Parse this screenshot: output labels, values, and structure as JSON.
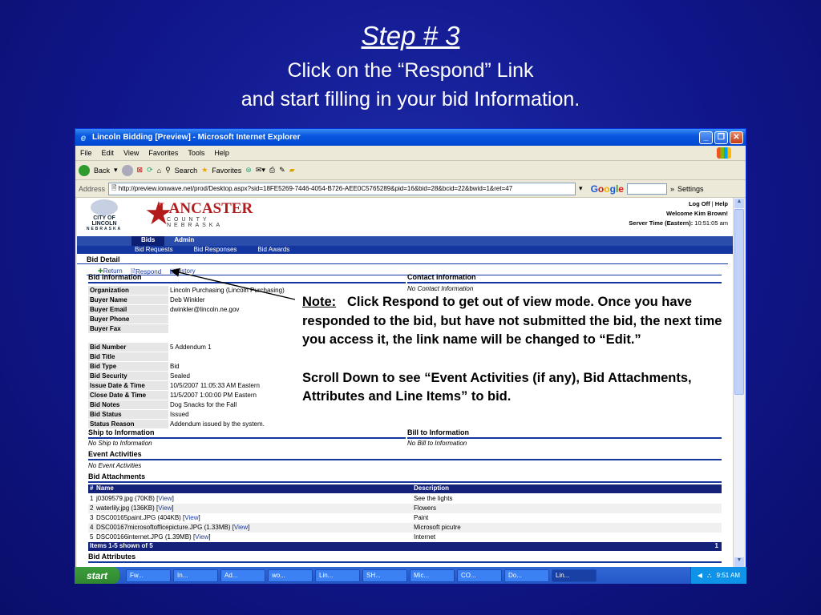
{
  "slide": {
    "step_title": "Step # 3",
    "line1": "Click on the “Respond” Link",
    "line2": "and start filling in your bid Information."
  },
  "browser": {
    "title": "Lincoln Bidding [Preview] - Microsoft Internet Explorer",
    "menu": [
      "File",
      "Edit",
      "View",
      "Favorites",
      "Tools",
      "Help"
    ],
    "toolbar": {
      "back": "Back",
      "search": "Search",
      "favorites": "Favorites"
    },
    "address_label": "Address",
    "address_url": "http://preview.ionwave.net/prod/Desktop.aspx?sid=18FE5269-7446-4054-B726-AEE0C5765289&pid=16&bid=28&bcid=22&bwid=1&ret=47",
    "settings_label": "Settings"
  },
  "page": {
    "city_logo_text": "CITY OF LINCOLN",
    "city_logo_sub": "NEBRASKA",
    "county_name": "LANCASTER",
    "county_sub": "COUNTY NEBRASKA",
    "log_off": "Log Off",
    "help": "Help",
    "welcome": "Welcome Kim Brown!",
    "server_time_label": "Server Time (Eastern):",
    "server_time": "10:51:05 am",
    "nav": [
      "Bids",
      "Admin"
    ],
    "subnav": [
      "Bid Requests",
      "Bid Responses",
      "Bid Awards"
    ],
    "bid_detail": "Bid Detail",
    "links": {
      "return": "Return",
      "respond": "Respond",
      "history": "History"
    },
    "bid_info_title": "Bid Information",
    "contact_title": "Contact Information",
    "no_contact": "No Contact Information",
    "fields": [
      {
        "label": "Organization",
        "value": "Lincoln Purchasing (Lincoln Purchasing)"
      },
      {
        "label": "Buyer Name",
        "value": "Deb Winkler"
      },
      {
        "label": "Buyer Email",
        "value": "dwinkler@lincoln.ne.gov"
      },
      {
        "label": "Buyer Phone",
        "value": ""
      },
      {
        "label": "Buyer Fax",
        "value": ""
      }
    ],
    "fields2": [
      {
        "label": "Bid Number",
        "value": "5 Addendum 1"
      },
      {
        "label": "Bid Title",
        "value": ""
      },
      {
        "label": "Bid Type",
        "value": "Bid"
      },
      {
        "label": "Bid Security",
        "value": "Sealed"
      },
      {
        "label": "Issue Date & Time",
        "value": "10/5/2007 11:05:33 AM Eastern"
      },
      {
        "label": "Close Date & Time",
        "value": "11/5/2007 1:00:00 PM Eastern"
      },
      {
        "label": "Bid Notes",
        "value": "Dog Snacks for the Fall"
      },
      {
        "label": "Bid Status",
        "value": "Issued"
      },
      {
        "label": "Status Reason",
        "value": "Addendum issued by the system."
      }
    ],
    "ship_title": "Ship to Information",
    "no_ship": "No Ship to Information",
    "bill_title": "Bill to Information",
    "no_bill": "No Bill to Information",
    "event_title": "Event Activities",
    "no_event": "No Event Activities",
    "attach_title": "Bid Attachments",
    "attach_cols": [
      "#",
      "Name",
      "Description"
    ],
    "attachments": [
      {
        "n": "1",
        "name": "j0309579.jpg (70KB)",
        "desc": "See the lights"
      },
      {
        "n": "2",
        "name": "waterlily.jpg (136KB)",
        "desc": "Flowers"
      },
      {
        "n": "3",
        "name": "DSC00165paint.JPG (404KB)",
        "desc": "Paint"
      },
      {
        "n": "4",
        "name": "DSC00167microsoftofficepicture.JPG (1.33MB)",
        "desc": "Microsoft picutre"
      },
      {
        "n": "5",
        "name": "DSC00166internet.JPG (1.39MB)",
        "desc": "Internet"
      }
    ],
    "view_label": "View",
    "items_shown": "Items 1-5 shown of 5",
    "page_num": "1",
    "attributes_title": "Bid Attributes"
  },
  "note": {
    "label": "Note:",
    "text": "Click Respond to get out of view mode.   Once you have responded to the bid, but have not submitted the bid, the next time you access it, the link name will be changed to “Edit.”",
    "scroll_text": "Scroll Down to see “Event Activities (if any), Bid Attachments, Attributes and Line Items” to bid."
  },
  "taskbar": {
    "start": "start",
    "tasks": [
      "Fw...",
      "In...",
      "Ad...",
      "wo...",
      "Lin...",
      "SH...",
      "Mic...",
      "CO...",
      "Do...",
      "Lin..."
    ],
    "clock": "9:51 AM"
  }
}
